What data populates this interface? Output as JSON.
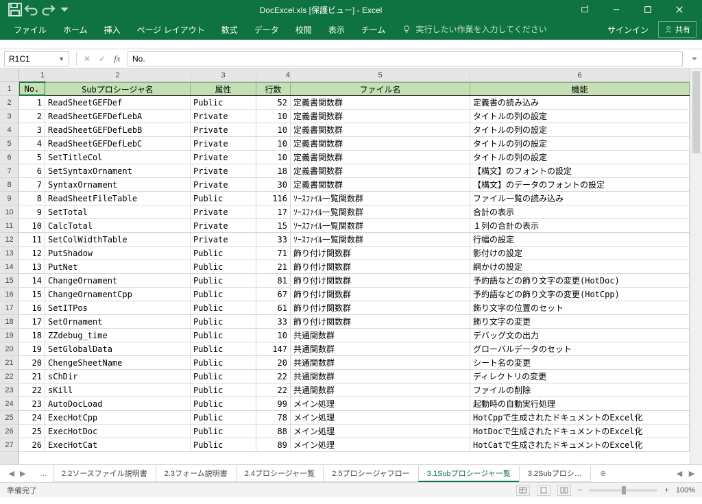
{
  "app": {
    "title": "DocExcel.xls  [保護ビュー]  -  Excel",
    "signin": "サインイン",
    "share": "共有",
    "tellme_placeholder": "実行したい作業を入力してください"
  },
  "ribbon": {
    "tabs": [
      "ファイル",
      "ホーム",
      "挿入",
      "ページ レイアウト",
      "数式",
      "データ",
      "校閲",
      "表示",
      "チーム"
    ]
  },
  "formula": {
    "namebox": "R1C1",
    "content": "No."
  },
  "columns": [
    "1",
    "2",
    "3",
    "4",
    "5",
    "6"
  ],
  "headers": {
    "no": "No.",
    "sub": "Subプロシージャ名",
    "attr": "属性",
    "lines": "行数",
    "file": "ファイル名",
    "func": "機能"
  },
  "rows": [
    {
      "no": "1",
      "sub": "ReadSheetGEFDef",
      "attr": "Public",
      "lines": "52",
      "file": "定義書関数群",
      "func": "定義書の読み込み"
    },
    {
      "no": "2",
      "sub": "ReadSheetGEFDefLebA",
      "attr": "Private",
      "lines": "10",
      "file": "定義書関数群",
      "func": "タイトルの列の設定"
    },
    {
      "no": "3",
      "sub": "ReadSheetGEFDefLebB",
      "attr": "Private",
      "lines": "10",
      "file": "定義書関数群",
      "func": "タイトルの列の設定"
    },
    {
      "no": "4",
      "sub": "ReadSheetGEFDefLebC",
      "attr": "Private",
      "lines": "10",
      "file": "定義書関数群",
      "func": "タイトルの列の設定"
    },
    {
      "no": "5",
      "sub": "SetTitleCol",
      "attr": "Private",
      "lines": "10",
      "file": "定義書関数群",
      "func": "タイトルの列の設定"
    },
    {
      "no": "6",
      "sub": "SetSyntaxOrnament",
      "attr": "Private",
      "lines": "18",
      "file": "定義書関数群",
      "func": "【構文】のフォントの設定"
    },
    {
      "no": "7",
      "sub": "SyntaxOrnament",
      "attr": "Private",
      "lines": "30",
      "file": "定義書関数群",
      "func": "【構文】のデータのフォントの設定"
    },
    {
      "no": "8",
      "sub": "ReadSheetFileTable",
      "attr": "Public",
      "lines": "116",
      "file": "ｿｰｽﾌｧｲﾙ一覧関数群",
      "func": "ファイル一覧の読み込み"
    },
    {
      "no": "9",
      "sub": "SetTotal",
      "attr": "Private",
      "lines": "17",
      "file": "ｿｰｽﾌｧｲﾙ一覧関数群",
      "func": "合計の表示"
    },
    {
      "no": "10",
      "sub": "CalcTotal",
      "attr": "Private",
      "lines": "15",
      "file": "ｿｰｽﾌｧｲﾙ一覧関数群",
      "func": "１列の合計の表示"
    },
    {
      "no": "11",
      "sub": "SetColWidthTable",
      "attr": "Private",
      "lines": "33",
      "file": "ｿｰｽﾌｧｲﾙ一覧関数群",
      "func": "行幅の設定"
    },
    {
      "no": "12",
      "sub": "PutShadow",
      "attr": "Public",
      "lines": "71",
      "file": "飾り付け関数群",
      "func": "影付けの設定"
    },
    {
      "no": "13",
      "sub": "PutNet",
      "attr": "Public",
      "lines": "21",
      "file": "飾り付け関数群",
      "func": "網かけの設定"
    },
    {
      "no": "14",
      "sub": "ChangeOrnament",
      "attr": "Public",
      "lines": "81",
      "file": "飾り付け関数群",
      "func": "予約語などの飾り文字の変更(HotDoc)"
    },
    {
      "no": "15",
      "sub": "ChangeOrnamentCpp",
      "attr": "Public",
      "lines": "67",
      "file": "飾り付け関数群",
      "func": "予約語などの飾り文字の変更(HotCpp)"
    },
    {
      "no": "16",
      "sub": "SetITPos",
      "attr": "Public",
      "lines": "61",
      "file": "飾り付け関数群",
      "func": "飾り文字の位置のセット"
    },
    {
      "no": "17",
      "sub": "SetOrnament",
      "attr": "Public",
      "lines": "33",
      "file": "飾り付け関数群",
      "func": "飾り文字の変更"
    },
    {
      "no": "18",
      "sub": "ZZdebug_time",
      "attr": "Public",
      "lines": "10",
      "file": "共通関数群",
      "func": "デバッグ文の出力"
    },
    {
      "no": "19",
      "sub": "SetGlobalData",
      "attr": "Public",
      "lines": "147",
      "file": "共通関数群",
      "func": "グローバルデータのセット"
    },
    {
      "no": "20",
      "sub": "ChengeSheetName",
      "attr": "Public",
      "lines": "20",
      "file": "共通関数群",
      "func": "シート名の変更"
    },
    {
      "no": "21",
      "sub": "sChDir",
      "attr": "Public",
      "lines": "22",
      "file": "共通関数群",
      "func": "ディレクトリの変更"
    },
    {
      "no": "22",
      "sub": "sKill",
      "attr": "Public",
      "lines": "22",
      "file": "共通関数群",
      "func": "ファイルの削除"
    },
    {
      "no": "23",
      "sub": "AutoDocLoad",
      "attr": "Public",
      "lines": "99",
      "file": "メイン処理",
      "func": "起動時の自動実行処理"
    },
    {
      "no": "24",
      "sub": "ExecHotCpp",
      "attr": "Public",
      "lines": "78",
      "file": "メイン処理",
      "func": "HotCppで生成されたドキュメントのExcel化"
    },
    {
      "no": "25",
      "sub": "ExecHotDoc",
      "attr": "Public",
      "lines": "88",
      "file": "メイン処理",
      "func": "HotDocで生成されたドキュメントのExcel化"
    },
    {
      "no": "26",
      "sub": "ExecHotCat",
      "attr": "Public",
      "lines": "89",
      "file": "メイン処理",
      "func": "HotCatで生成されたドキュメントのExcel化"
    }
  ],
  "tabs": {
    "items": [
      "2.2ソースファイル説明書",
      "2.3フォーム説明書",
      "2.4プロシージャ一覧",
      "2.5プロシージャフロー",
      "3.1Subプロシージャ一覧",
      "3.2Subプロシ… "
    ],
    "active": 4
  },
  "status": {
    "ready": "準備完了",
    "zoom": "100%"
  }
}
